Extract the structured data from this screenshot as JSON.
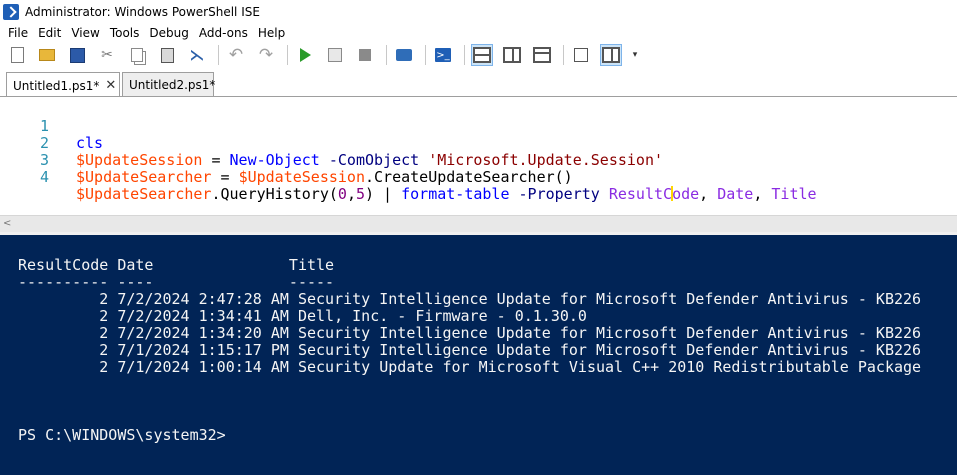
{
  "window": {
    "title": "Administrator: Windows PowerShell ISE"
  },
  "menu": [
    "File",
    "Edit",
    "View",
    "Tools",
    "Debug",
    "Add-ons",
    "Help"
  ],
  "toolbar": {
    "icons": [
      "new-icon",
      "open-icon",
      "save-icon",
      "cut-icon",
      "copy-icon",
      "paste-icon",
      "powershell-icon",
      "undo-icon",
      "redo-icon",
      "run-icon",
      "run-selection-icon",
      "stop-icon",
      "remote-tab-icon",
      "powershell-console-icon",
      "layout-top-icon",
      "layout-right-icon",
      "layout-max-icon",
      "command-addon-icon",
      "show-script-pane-icon",
      "more-icon"
    ],
    "powershell_glyph": ">_"
  },
  "tabs": [
    {
      "label": "Untitled1.ps1*",
      "active": true,
      "close": "✕"
    },
    {
      "label": "Untitled2.ps1*",
      "active": false
    }
  ],
  "editor": {
    "lines": [
      {
        "num": "1",
        "t1": "cls"
      },
      {
        "num": "2",
        "t1": "$UpdateSession",
        "t2": " = ",
        "t3": "New-Object",
        "t4": " -ComObject ",
        "t5": "'Microsoft.Update.Session'"
      },
      {
        "num": "3",
        "t1": "$UpdateSearcher",
        "t2": " = ",
        "t3": "$UpdateSession",
        "t4": ".CreateUpdateSearcher()"
      },
      {
        "num": "4",
        "t1": "$UpdateSearcher",
        "t2": ".QueryHistory(",
        "t3": "0",
        "t4": ",",
        "t5": "5",
        "t6": ") | ",
        "t7": "format-table",
        "t8": " -Property ",
        "t9": "ResultC",
        "t10": "ode",
        "t11": ", ",
        "t12": "Date",
        "t13": ", ",
        "t14": "Title"
      }
    ]
  },
  "scrollbar": {
    "left_arrow": "<"
  },
  "console": {
    "lines": [
      "ResultCode Date               Title",
      "---------- ----               -----",
      "         2 7/2/2024 2:47:28 AM Security Intelligence Update for Microsoft Defender Antivirus - KB226",
      "         2 7/2/2024 1:34:41 AM Dell, Inc. - Firmware - 0.1.30.0",
      "         2 7/2/2024 1:34:20 AM Security Intelligence Update for Microsoft Defender Antivirus - KB226",
      "         2 7/1/2024 1:15:17 PM Security Intelligence Update for Microsoft Defender Antivirus - KB226",
      "         2 7/1/2024 1:00:14 AM Security Update for Microsoft Visual C++ 2010 Redistributable Package",
      "PS C:\\WINDOWS\\system32>"
    ]
  },
  "colors": {
    "console_bg": "#012456",
    "console_fg": "#f5f5f5",
    "line_number": "#2b91af",
    "keyword": "#0000ff",
    "variable": "#ff4500",
    "string": "#8b0000",
    "number": "#800080",
    "property": "#8a2be2"
  }
}
